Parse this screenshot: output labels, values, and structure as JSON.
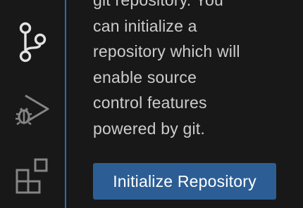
{
  "activity_bar": {
    "items": [
      {
        "icon": "source-control-icon",
        "active": true,
        "color": "#e3e3e3"
      },
      {
        "icon": "run-and-debug-icon",
        "active": false,
        "color": "#858585"
      },
      {
        "icon": "extensions-icon",
        "active": false,
        "color": "#858585"
      }
    ]
  },
  "source_control": {
    "message_lines": [
      "git repository. You",
      "can initialize a",
      "repository which will",
      "enable source",
      "control features",
      "powered by git."
    ],
    "initialize_button_label": "Initialize Repository"
  },
  "colors": {
    "background": "#181818",
    "accent_border": "#2b6cb0",
    "button_background": "#2c5e95",
    "text": "#cccccc"
  }
}
